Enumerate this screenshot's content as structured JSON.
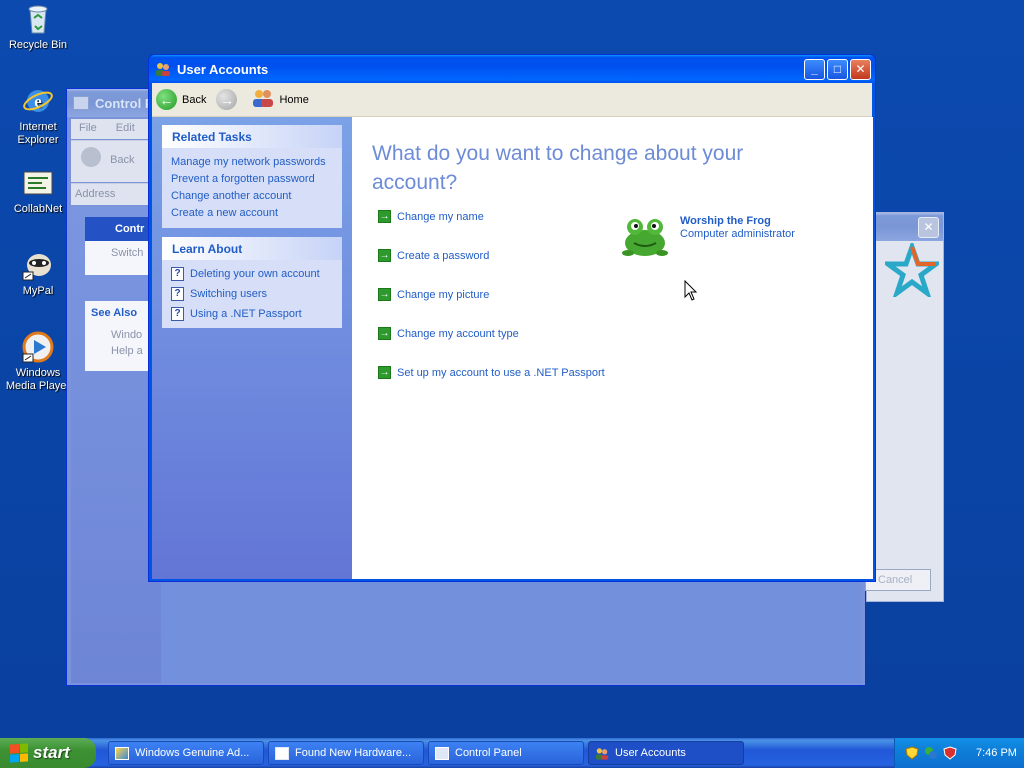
{
  "desktop": {
    "icons": [
      {
        "label": "Recycle Bin",
        "icon": "recycle-bin-icon"
      },
      {
        "label": "Internet Explorer",
        "icon": "internet-explorer-icon"
      },
      {
        "label": "CollabNet",
        "icon": "collabnet-icon"
      },
      {
        "label": "MyPal",
        "icon": "mypal-icon"
      },
      {
        "label": "Windows Media Player",
        "icon": "windows-media-player-icon"
      }
    ]
  },
  "control_panel": {
    "title": "Control P",
    "menu": [
      "File",
      "Edit"
    ],
    "back_label": "Back",
    "address_label": "Address",
    "box1_title": "Contr",
    "box1_item": "Switch",
    "see_also": {
      "title": "See Also",
      "items": [
        "Windo",
        "Help a"
      ]
    }
  },
  "dialog_bg": {
    "cancel_label": "Cancel"
  },
  "user_accounts": {
    "title": "User Accounts",
    "nav": {
      "back": "Back",
      "home": "Home"
    },
    "related_tasks": {
      "title": "Related Tasks",
      "links": [
        "Manage my network passwords",
        "Prevent a forgotten password",
        "Change another account",
        "Create a new account"
      ]
    },
    "learn_about": {
      "title": "Learn About",
      "links": [
        "Deleting your own account",
        "Switching users",
        "Using a .NET Passport"
      ]
    },
    "heading": "What do you want to change about your account?",
    "actions": [
      "Change my name",
      "Create a password",
      "Change my picture",
      "Change my account type",
      "Set up my account to use a .NET Passport"
    ],
    "account": {
      "name": "Worship the Frog",
      "role": "Computer administrator"
    }
  },
  "taskbar": {
    "start": "start",
    "buttons": [
      {
        "label": "Windows Genuine Ad...",
        "icon": "genuine-advantage-icon",
        "active": false
      },
      {
        "label": "Found New Hardware...",
        "icon": "window-icon",
        "active": false
      },
      {
        "label": "Control Panel",
        "icon": "control-panel-icon",
        "active": false
      },
      {
        "label": "User Accounts",
        "icon": "user-accounts-icon",
        "active": true
      }
    ],
    "clock": "7:46 PM"
  },
  "colors": {
    "desktop": "#0a46a8",
    "link": "#215dc6",
    "heading": "#6d8bd6",
    "action_arrow": "#2e9a2e"
  }
}
